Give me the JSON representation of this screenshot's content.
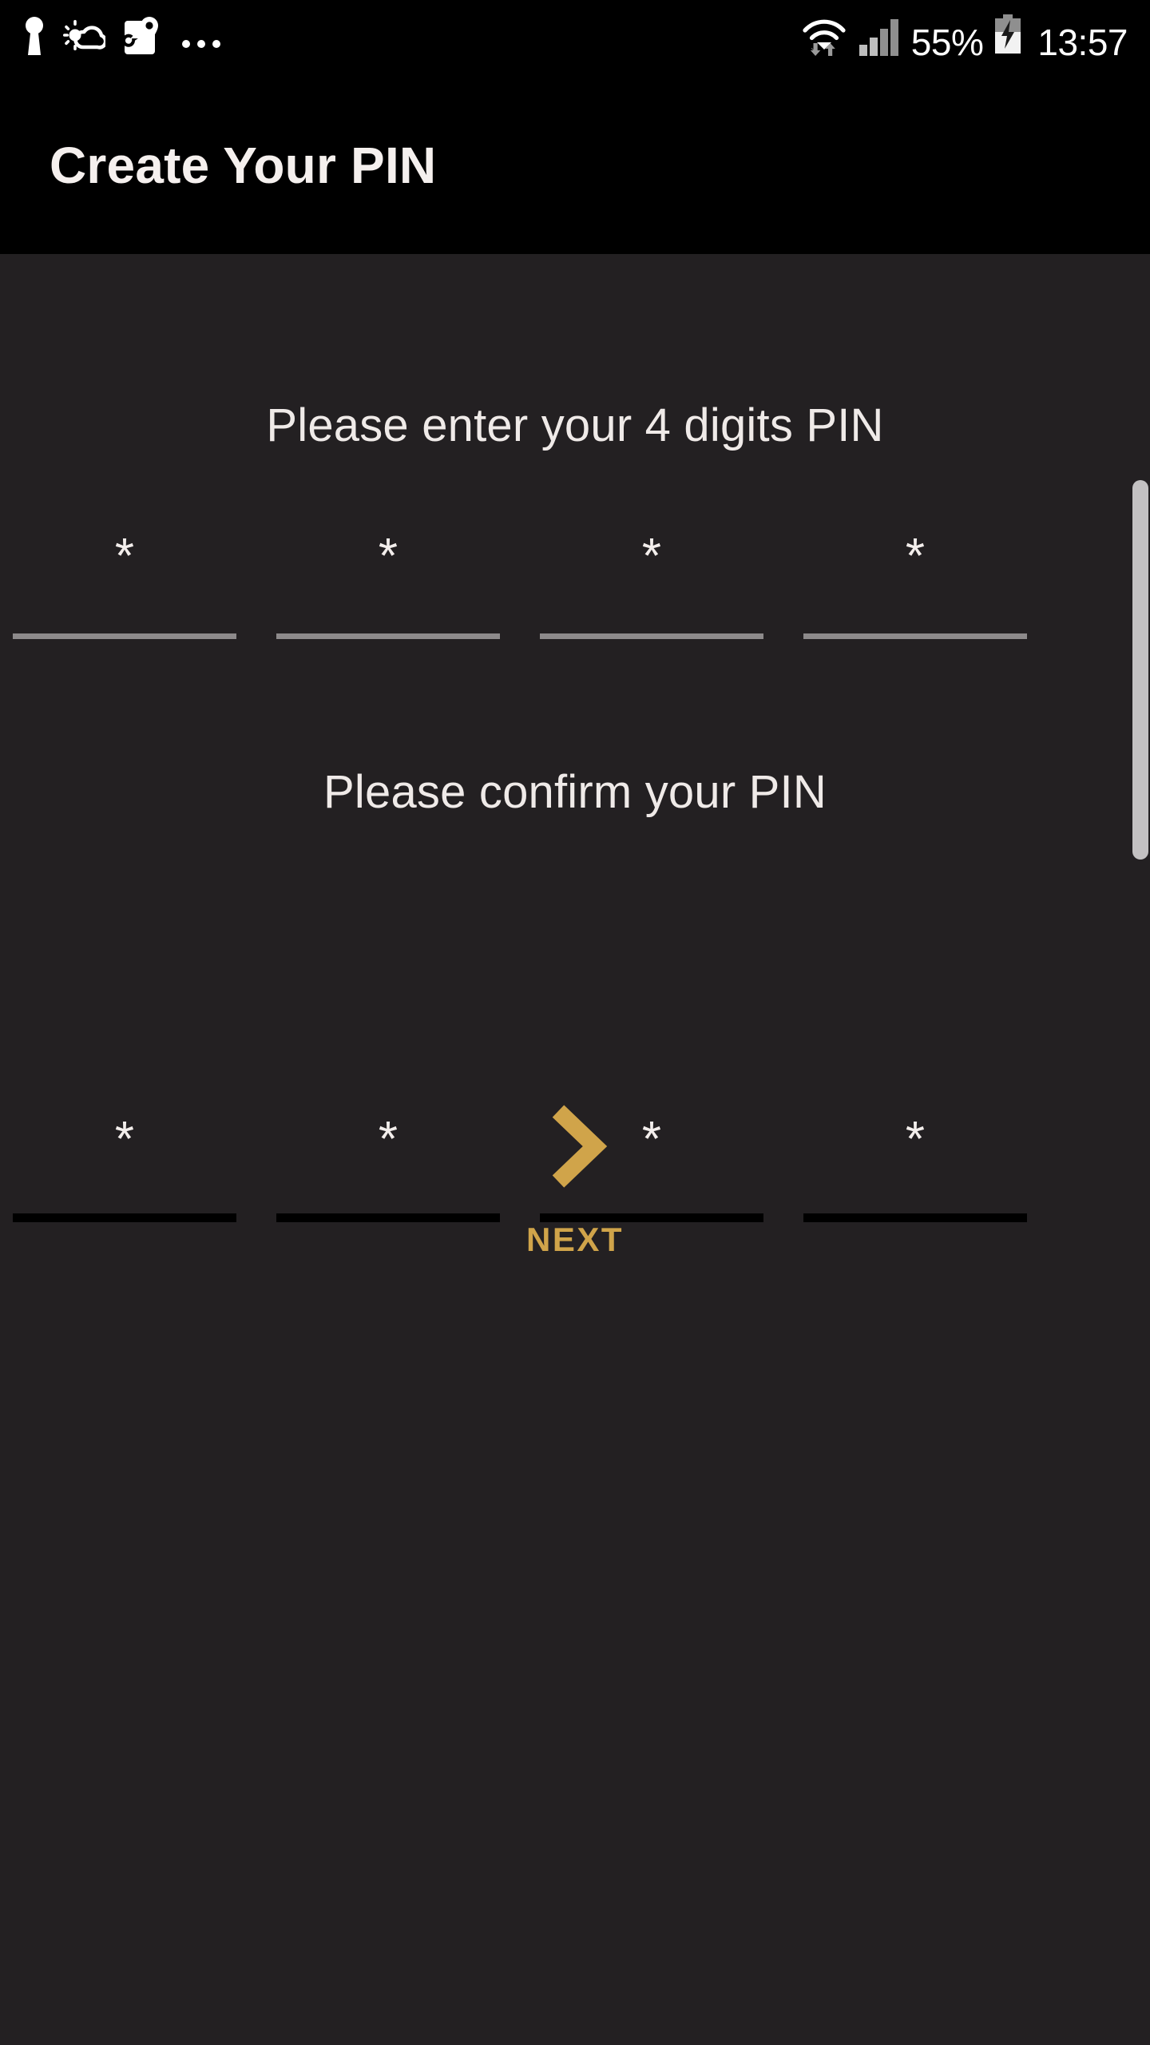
{
  "status_bar": {
    "left_icons": [
      {
        "name": "keyhole-icon",
        "label": "keyhole"
      },
      {
        "name": "weather-partly-cloudy-icon",
        "label": "weather"
      },
      {
        "name": "google-maps-icon",
        "label": "maps"
      }
    ],
    "overflow_label": "...",
    "right_icons": [
      {
        "name": "wifi-data-transfer-icon",
        "label": "wifi"
      },
      {
        "name": "cellular-signal-icon",
        "label": "signal"
      },
      {
        "name": "battery-charging-icon",
        "label": "battery"
      }
    ],
    "battery_percent": "55%",
    "clock": "13:57"
  },
  "header": {
    "title": "Create Your PIN"
  },
  "main": {
    "enter_prompt": "Please enter your 4 digits PIN",
    "confirm_prompt": "Please confirm your PIN",
    "enter_pin": {
      "name": "pin-entry-row",
      "mask_char": "*",
      "values": [
        "*",
        "*",
        "*",
        "*"
      ]
    },
    "confirm_pin": {
      "name": "pin-confirm-row",
      "mask_char": "*",
      "values": [
        "*",
        "*",
        "*",
        "*"
      ]
    },
    "next": {
      "label": "NEXT",
      "icon": "chevron-right-icon"
    }
  },
  "colors": {
    "status_bar_bg": "#000000",
    "title_bar_bg": "#000000",
    "body_bg": "#232022",
    "text_primary": "#efeae8",
    "accent_gold": "#d0a44a",
    "underline_inactive": "#8d8a8b",
    "underline_active": "#000000",
    "scrollbar_thumb": "#c3c1c2"
  }
}
